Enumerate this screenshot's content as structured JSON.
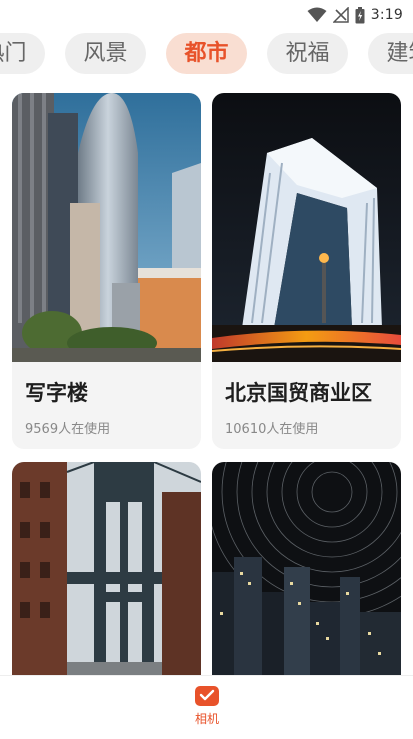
{
  "status_bar": {
    "time": "3:19",
    "icons": [
      "wifi-icon",
      "signal-icon",
      "battery-icon"
    ]
  },
  "tabs": [
    {
      "label": "热门",
      "active": false
    },
    {
      "label": "风景",
      "active": false
    },
    {
      "label": "都市",
      "active": true
    },
    {
      "label": "祝福",
      "active": false
    },
    {
      "label": "建筑",
      "active": false
    }
  ],
  "cards": [
    {
      "title": "写字楼",
      "usage": "9569人在使用",
      "image": "office-towers-photo"
    },
    {
      "title": "北京国贸商业区",
      "usage": "10610人在使用",
      "image": "cctv-tower-night-photo"
    },
    {
      "title": "",
      "usage": "",
      "image": "bridge-street-photo"
    },
    {
      "title": "",
      "usage": "",
      "image": "night-city-star-trails-photo"
    }
  ],
  "bottom_nav": {
    "label": "相机",
    "icon": "camera-icon"
  },
  "colors": {
    "accent": "#e8522a",
    "active_tab_bg": "#f9ded2",
    "tab_bg": "#efefef",
    "card_bg": "#f4f4f4"
  }
}
